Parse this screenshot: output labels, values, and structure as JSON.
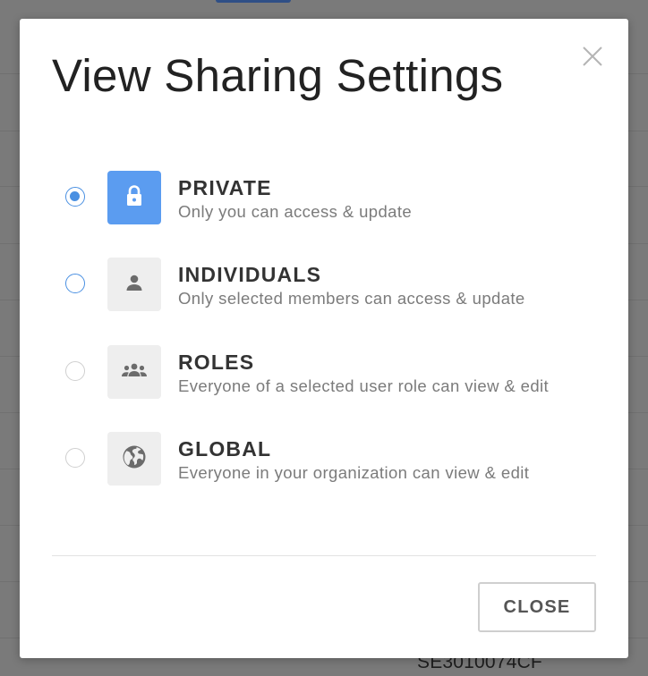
{
  "background": {
    "partial_code": "SE3010074CF"
  },
  "dialog": {
    "title": "View Sharing Settings",
    "close_icon": "close-icon",
    "close_button_label": "CLOSE",
    "accent_color": "#4a90e2",
    "options": [
      {
        "title": "PRIVATE",
        "description": "Only you can access & update",
        "icon": "lock-icon",
        "selected": true
      },
      {
        "title": "INDIVIDUALS",
        "description": "Only selected members can access & update",
        "icon": "person-icon",
        "selected": false
      },
      {
        "title": "ROLES",
        "description": "Everyone of a selected user role can view & edit",
        "icon": "group-icon",
        "selected": false
      },
      {
        "title": "GLOBAL",
        "description": "Everyone in your organization can view & edit",
        "icon": "globe-icon",
        "selected": false
      }
    ]
  }
}
